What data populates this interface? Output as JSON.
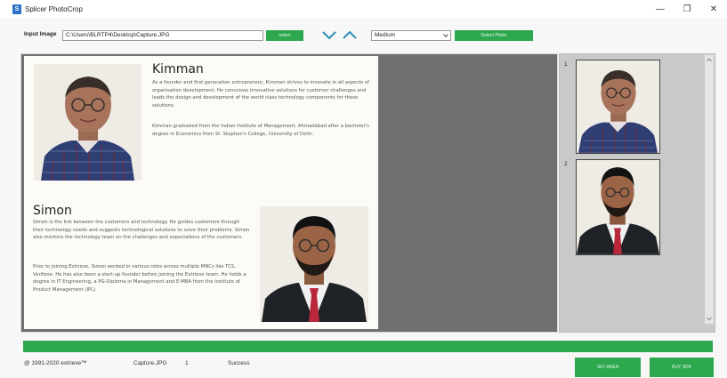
{
  "window": {
    "title": "Splicer PhotoCrop",
    "app_icon": "S",
    "controls": {
      "minimize": "—",
      "restore": "❐",
      "close": "✕"
    }
  },
  "toolbar": {
    "input_label": "Input Image",
    "input_path": "C:\\Users\\BLRTP4\\Desktop\\Capture.JPG",
    "select_label": "select",
    "mode_value": "Medium",
    "detect_label": "Detect Photo"
  },
  "document": {
    "person1": {
      "name": "Kimman",
      "para1": "As a founder and first generation entrepreneur, Kimman strives to innovate in all aspects of organisation development. He conceives innovative solutions for customer challenges and leads the design and development of the world class technology components for these solutions.",
      "para2": "Kimman graduated from the Indian Institute of Management, Ahmadabad after a bachelor's degree in Economics from St. Stephen's College, University of Delhi."
    },
    "person2": {
      "name": "Simon",
      "para1": "Simon is the link between the customers and technology. He guides customers through their technology needs and suggests technological solutions to solve their problems. Simon also mentors the technology team on the challenges and expectations of the customers.",
      "para2": "Prior to joining Extrieve, Simon worked in various roles across multiple MNCs like TCS, Verifone. He has also been a start-up founder before joining the Extrieve team. He holds a degree in IT Engineering, a PG-Diploma in Management and E-MBA from the Institute of Product Management (IPL)."
    }
  },
  "thumbnails": [
    {
      "index": "1"
    },
    {
      "index": "2"
    }
  ],
  "progress": {
    "fraction": 1.0
  },
  "status": {
    "copyright": "@ 1991-2020 extrieve™",
    "filename": "Capture.JPG",
    "count": "1",
    "state": "Success"
  },
  "actions": {
    "set_area": "SET AREA",
    "buy": "BUY SDK"
  },
  "colors": {
    "accent_green": "#2ea84f",
    "doc_bg": "#6f7070",
    "panel_bg": "#c9c9c9"
  }
}
